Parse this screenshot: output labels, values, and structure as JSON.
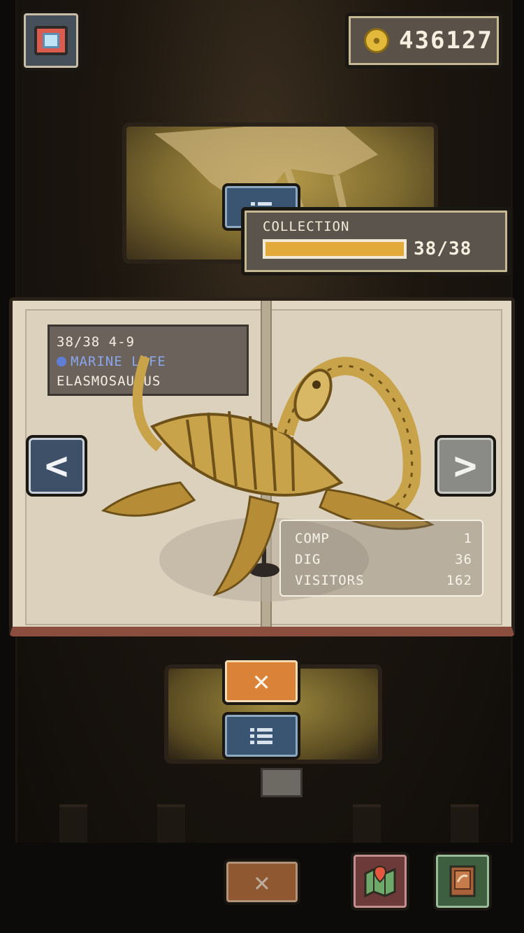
{
  "header": {
    "coins": "436127"
  },
  "collection": {
    "label": "COLLECTION",
    "count": "38/38",
    "progress": 1.0
  },
  "entry": {
    "index_line": "38/38 4-9",
    "category": "MARINE LIFE",
    "category_color": "#5f7ed7",
    "name": "ELASMOSAURUS"
  },
  "stats": [
    {
      "label": "COMP",
      "value": "1"
    },
    {
      "label": "DIG",
      "value": "36"
    },
    {
      "label": "VISITORS",
      "value": "162"
    }
  ],
  "buttons": {
    "prev_glyph": "<",
    "next_glyph": ">",
    "close_glyph": "✕"
  },
  "icons": {
    "camera": "camera-icon",
    "coin": "coin-icon",
    "list": "list-icon",
    "map": "map-icon",
    "book": "book-icon"
  },
  "colors": {
    "accent_orange": "#d98238",
    "accent_blue": "#3a5572",
    "progress_fill": "#e2aa3a",
    "book_border": "#8a4d3e"
  }
}
